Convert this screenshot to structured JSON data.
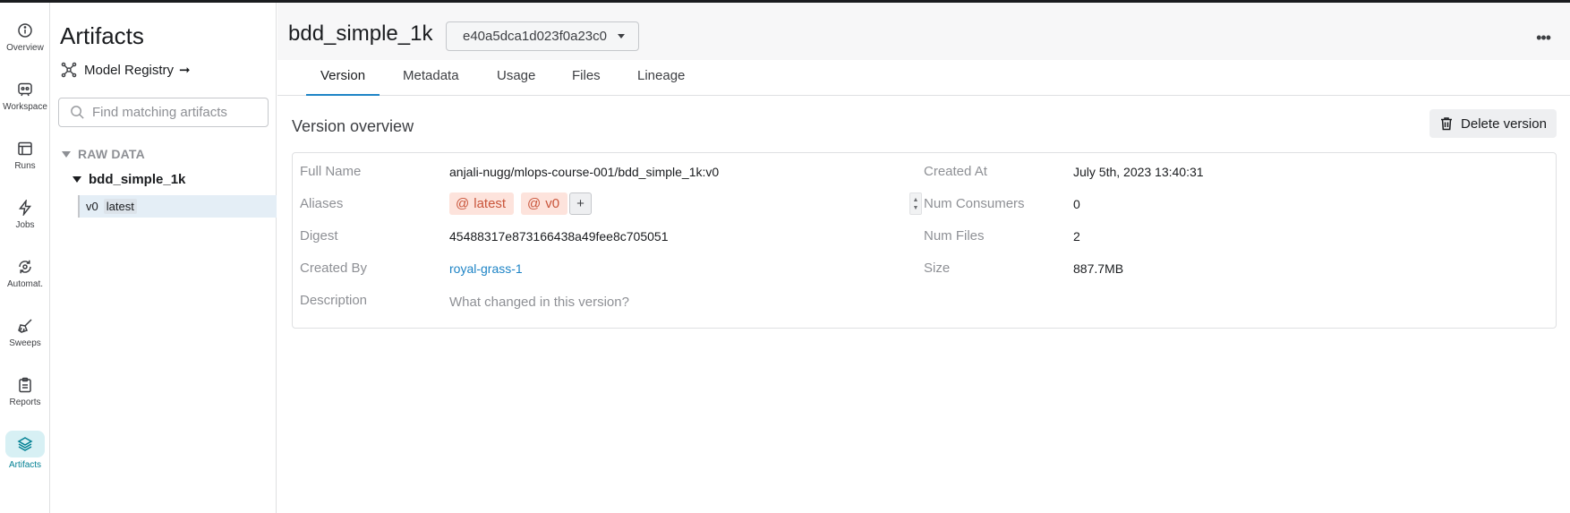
{
  "rail": {
    "items": [
      {
        "label": "Overview",
        "icon": "info-icon"
      },
      {
        "label": "Workspace",
        "icon": "workspace-icon"
      },
      {
        "label": "Runs",
        "icon": "runs-icon"
      },
      {
        "label": "Jobs",
        "icon": "jobs-icon"
      },
      {
        "label": "Automat.",
        "icon": "automations-icon"
      },
      {
        "label": "Sweeps",
        "icon": "sweeps-icon"
      },
      {
        "label": "Reports",
        "icon": "reports-icon"
      },
      {
        "label": "Artifacts",
        "icon": "artifacts-icon",
        "active": true
      }
    ]
  },
  "sidebar": {
    "title": "Artifacts",
    "model_registry": "Model Registry",
    "registry_arrow": "➞",
    "search_placeholder": "Find matching artifacts",
    "group": "RAW DATA",
    "artifact": "bdd_simple_1k",
    "version": {
      "name": "v0",
      "alias": "latest"
    }
  },
  "header": {
    "title": "bdd_simple_1k",
    "digest": "e40a5dca1d023f0a23c0",
    "more": "•••"
  },
  "tabs": [
    "Version",
    "Metadata",
    "Usage",
    "Files",
    "Lineage"
  ],
  "overview": {
    "title": "Version overview",
    "delete_label": "Delete version",
    "labels": {
      "full_name": "Full Name",
      "aliases": "Aliases",
      "digest": "Digest",
      "created_by": "Created By",
      "description": "Description",
      "created_at": "Created At",
      "num_consumers": "Num Consumers",
      "num_files": "Num Files",
      "size": "Size"
    },
    "values": {
      "full_name": "anjali-nugg/mlops-course-001/bdd_simple_1k:v0",
      "aliases": [
        "latest",
        "v0"
      ],
      "alias_prefix": "@",
      "add_alias": "+",
      "digest": "45488317e873166438a49fee8c705051",
      "created_by": "royal-grass-1",
      "description_placeholder": "What changed in this version?",
      "created_at": "July 5th, 2023 13:40:31",
      "num_consumers": "0",
      "num_files": "2",
      "size": "887.7MB"
    }
  },
  "colors": {
    "accent": "#1e84c6",
    "active_rail": "#038194",
    "alias_chip_bg": "#fde3dc",
    "alias_chip_text": "#c9553b"
  }
}
